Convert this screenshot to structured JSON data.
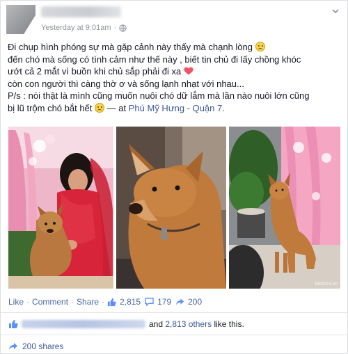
{
  "header": {
    "time": "Yesterday at 9:01am",
    "separator": "·"
  },
  "post": {
    "lines": [
      "Đi chụp hình phóng sự mà gặp cảnh này thấy mà chạnh lòng",
      "đến chó mà sống có tình cảm như thế này , biết tin chủ đi lấy chồng khóc",
      "ướt cả 2 mắt vì buồn khi chủ sắp phải đi xa",
      "còn con người thì càng thờ ơ và sống lạnh nhạt với nhau...",
      "P/s : nói thật là mình cũng muốn nuôi chó dữ lắm mà lần nào nuôi lớn cũng",
      "bị lũ trộm chó bắt hết"
    ],
    "at_text": "— at",
    "location": "Phú Mỹ Hưng - Quận 7.",
    "colors": {
      "link": "#3b5998",
      "text": "#141823",
      "meta": "#90949c"
    }
  },
  "photos": {
    "watermark": "kenh14.vn"
  },
  "actions": {
    "like": "Like",
    "comment": "Comment",
    "share": "Share",
    "dot": "·",
    "likes_count": "2,815",
    "comments_count": "179",
    "shares_count": "200"
  },
  "likes_summary": {
    "and_text": "and",
    "others_link": "2,813 others",
    "suffix": "like this."
  },
  "shares_summary": {
    "label": "200 shares"
  }
}
